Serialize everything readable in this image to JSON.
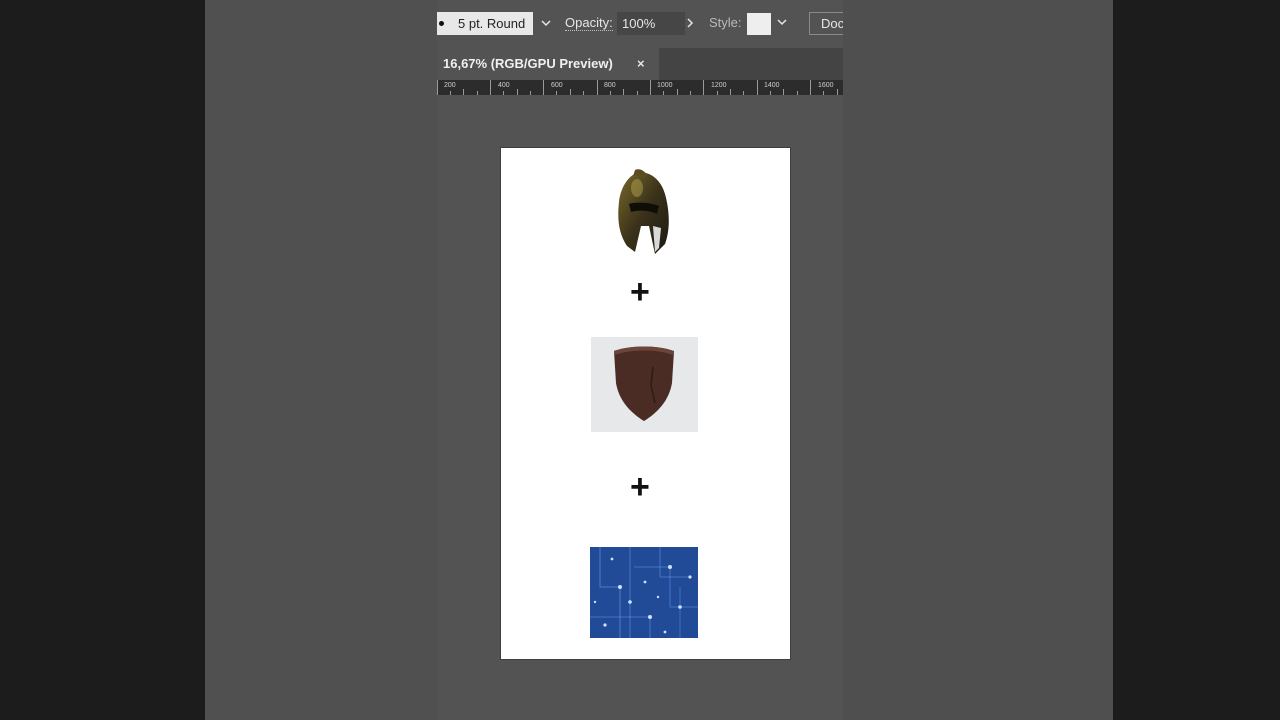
{
  "control_bar": {
    "stroke_profile": "5 pt. Round",
    "opacity_label": "Opacity:",
    "opacity_value": "100%",
    "style_label": "Style:",
    "document_setup_label": "Docu"
  },
  "document_tab": {
    "title": "16,67% (RGB/GPU Preview)",
    "close_glyph": "×"
  },
  "ruler": {
    "labels": [
      "200",
      "400",
      "600",
      "800",
      "1000",
      "1200",
      "1400",
      "1600"
    ]
  },
  "artboard": {
    "plus_glyph": "+",
    "images": [
      "helmet",
      "shield",
      "circuit-board"
    ]
  },
  "colors": {
    "ui_background": "#535353",
    "artboard": "#ffffff",
    "circuit_blue": "#1d3f86",
    "shield_brown": "#4a2c25"
  }
}
